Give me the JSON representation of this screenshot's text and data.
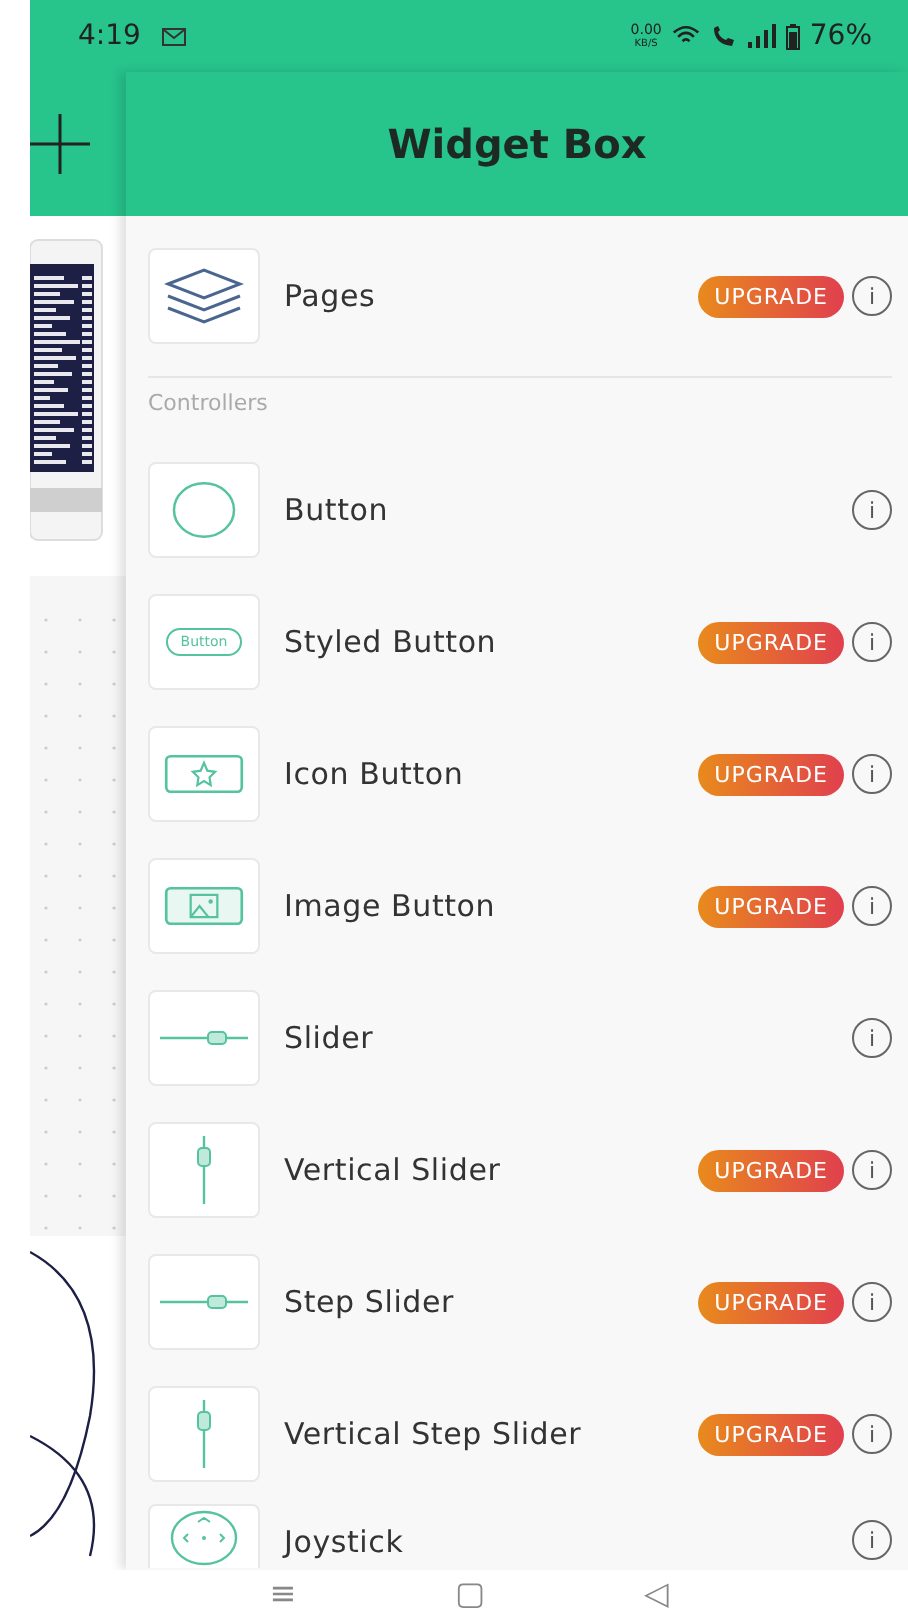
{
  "status_bar": {
    "time": "4:19",
    "speed_value": "0.00",
    "speed_unit": "KB/S",
    "battery": "76%"
  },
  "header": {
    "title": "Widget Box"
  },
  "featured": [
    {
      "name": "Pages",
      "kind": "layers",
      "upgrade": "UPGRADE",
      "info": "i"
    }
  ],
  "section_label": "Controllers",
  "widgets": [
    {
      "name": "Button",
      "kind": "circle",
      "info": "i"
    },
    {
      "name": "Styled Button",
      "kind": "styled",
      "icon_text": "Button",
      "upgrade": "UPGRADE",
      "info": "i"
    },
    {
      "name": "Icon Button",
      "kind": "icon-button",
      "upgrade": "UPGRADE",
      "info": "i"
    },
    {
      "name": "Image Button",
      "kind": "image-button",
      "upgrade": "UPGRADE",
      "info": "i"
    },
    {
      "name": "Slider",
      "kind": "slider",
      "info": "i"
    },
    {
      "name": "Vertical Slider",
      "kind": "vslider",
      "upgrade": "UPGRADE",
      "info": "i"
    },
    {
      "name": "Step Slider",
      "kind": "slider",
      "upgrade": "UPGRADE",
      "info": "i"
    },
    {
      "name": "Vertical Step Slider",
      "kind": "vslider",
      "upgrade": "UPGRADE",
      "info": "i"
    },
    {
      "name": "Joystick",
      "kind": "joystick",
      "info": "i"
    }
  ],
  "nav": {
    "menu": "≡",
    "home": "▢",
    "back": "◁"
  }
}
